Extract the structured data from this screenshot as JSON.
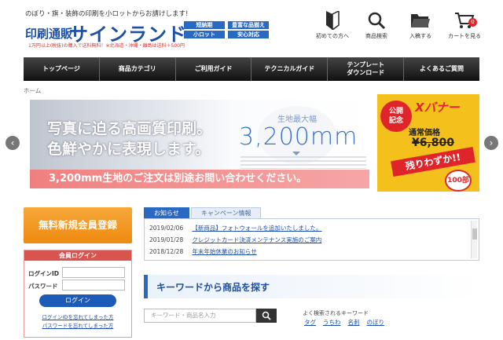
{
  "header": {
    "tagline": "のぼり・旗・装飾の印刷を小ロットからお請けします!",
    "logo_small": "印刷通販",
    "logo_big": "サインランド",
    "logo_note": "1万円以上(税抜)の購入で送料無料！※北海道・沖縄・離島は送料＋500円",
    "badges": [
      "短納期",
      "豊富な品揃え",
      "小ロット",
      "安心対応"
    ],
    "icons": [
      {
        "label": "初めての方へ",
        "icon": "beginner-mark-icon"
      },
      {
        "label": "商品検索",
        "icon": "search-icon"
      },
      {
        "label": "入稿する",
        "icon": "folder-icon"
      },
      {
        "label": "カートを見る",
        "icon": "cart-icon",
        "count": "0"
      }
    ]
  },
  "nav": [
    "トップページ",
    "商品カテゴリ",
    "ご利用ガイド",
    "テクニカルガイド",
    "テンプレート\nダウンロード",
    "よくあるご質問"
  ],
  "breadcrumb": "ホーム",
  "hero": {
    "line1": "写真に迫る高画質印刷。",
    "line2": "色鮮やかに表現します。",
    "label": "生地最大幅",
    "value": "3,200mm",
    "band": "3,200mm生地のご注文は別途お問い合わせください。"
  },
  "hero_side": {
    "badge": "公開\n記念",
    "title": "Xバナー",
    "price_label": "通常価格",
    "price": "¥6,800",
    "banner": "残りわずか!!",
    "circle": "100部"
  },
  "arrows": {
    "prev": "‹",
    "next": "›"
  },
  "register_button": "無料新規会員登録",
  "login": {
    "title": "会員ログイン",
    "id_label": "ログインID",
    "password_label": "パスワード",
    "button": "ログイン",
    "forgot_id": "ログインIDを忘れてしまった方",
    "forgot_password": "パスワードを忘れてしまった方"
  },
  "tabs": [
    "お知らせ",
    "キャンペーン情報"
  ],
  "news": [
    {
      "date": "2019/02/06",
      "title": "【新商品】フォトウォールを追加いたしました。"
    },
    {
      "date": "2019/01/28",
      "title": "クレジットカード決済メンテナンス実施のご案内"
    },
    {
      "date": "2018/12/28",
      "title": "年末年始休業のお知らせ"
    }
  ],
  "keyword": {
    "title": "キーワードから商品を探す",
    "placeholder": "キーワード・商品名入力",
    "popular_label": "よく検索されるキーワード",
    "tags": [
      "タグ",
      "うちわ",
      "名刺",
      "のぼり"
    ]
  },
  "colors": {
    "brand_blue": "#1e4fa3",
    "orange": "#ee8a10",
    "red": "#d9534f"
  }
}
